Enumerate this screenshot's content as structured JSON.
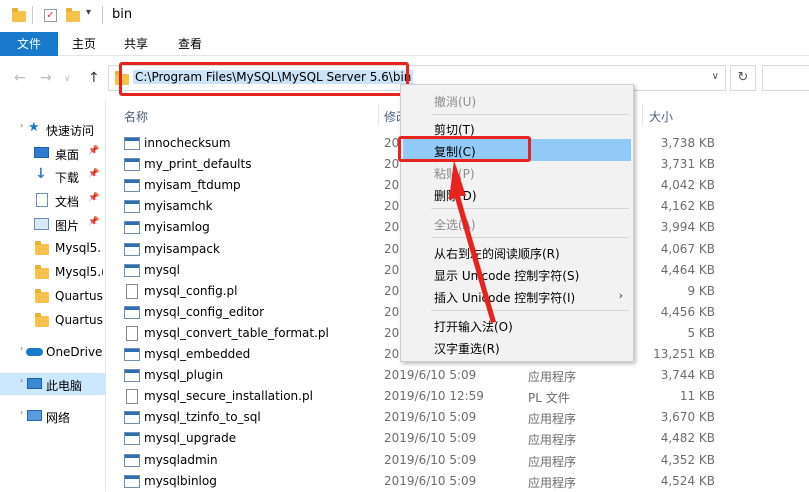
{
  "window": {
    "title": "bin"
  },
  "ribbon": {
    "tabs": [
      "文件",
      "主页",
      "共享",
      "查看"
    ]
  },
  "address": {
    "path": "C:\\Program Files\\MySQL\\MySQL Server 5.6\\bin"
  },
  "nav": {
    "items": [
      {
        "label": "快速访问",
        "icon": "star-icon"
      },
      {
        "label": "桌面",
        "icon": "desktop-icon",
        "pinned": true
      },
      {
        "label": "下载",
        "icon": "download-icon",
        "pinned": true
      },
      {
        "label": "文档",
        "icon": "document-icon",
        "pinned": true
      },
      {
        "label": "图片",
        "icon": "picture-icon",
        "pinned": true
      },
      {
        "label": "Mysql5.!",
        "icon": "folder-icon"
      },
      {
        "label": "Mysql5.(",
        "icon": "folder-icon"
      },
      {
        "label": "Quartus",
        "icon": "folder-icon"
      },
      {
        "label": "Quartus",
        "icon": "folder-icon"
      },
      {
        "label": "OneDrive",
        "icon": "cloud-icon"
      },
      {
        "label": "此电脑",
        "icon": "computer-icon"
      },
      {
        "label": "网络",
        "icon": "network-icon"
      }
    ]
  },
  "columns": {
    "name": "名称",
    "date": "修改",
    "size": "大小"
  },
  "files": [
    {
      "name": "innochecksum",
      "date": "20",
      "type": "",
      "size": "3,738 KB"
    },
    {
      "name": "my_print_defaults",
      "date": "20",
      "type": "",
      "size": "3,731 KB"
    },
    {
      "name": "myisam_ftdump",
      "date": "20",
      "type": "",
      "size": "4,042 KB"
    },
    {
      "name": "myisamchk",
      "date": "20",
      "type": "",
      "size": "4,162 KB"
    },
    {
      "name": "myisamlog",
      "date": "20",
      "type": "",
      "size": "3,994 KB"
    },
    {
      "name": "myisampack",
      "date": "20",
      "type": "",
      "size": "4,067 KB"
    },
    {
      "name": "mysql",
      "date": "20",
      "type": "",
      "size": "4,464 KB"
    },
    {
      "name": "mysql_config.pl",
      "date": "20",
      "type": "",
      "size": "9 KB"
    },
    {
      "name": "mysql_config_editor",
      "date": "20",
      "type": "",
      "size": "4,456 KB"
    },
    {
      "name": "mysql_convert_table_format.pl",
      "date": "20",
      "type": "",
      "size": "5 KB"
    },
    {
      "name": "mysql_embedded",
      "date": "20",
      "type": "",
      "size": "13,251 KB"
    },
    {
      "name": "mysql_plugin",
      "date": "2019/6/10 5:09",
      "type": "应用程序",
      "size": "3,744 KB"
    },
    {
      "name": "mysql_secure_installation.pl",
      "date": "2019/6/10 12:59",
      "type": "PL 文件",
      "size": "11 KB"
    },
    {
      "name": "mysql_tzinfo_to_sql",
      "date": "2019/6/10 5:09",
      "type": "应用程序",
      "size": "3,670 KB"
    },
    {
      "name": "mysql_upgrade",
      "date": "2019/6/10 5:09",
      "type": "应用程序",
      "size": "4,482 KB"
    },
    {
      "name": "mysqladmin",
      "date": "2019/6/10 5:09",
      "type": "应用程序",
      "size": "4,352 KB"
    },
    {
      "name": "mysqlbinlog",
      "date": "2019/6/10 5:09",
      "type": "应用程序",
      "size": "4,524 KB"
    }
  ],
  "context_menu": {
    "items": [
      {
        "label": "撤消(U)",
        "disabled": true
      },
      {
        "label": "剪切(T)",
        "disabled": false
      },
      {
        "label": "复制(C)",
        "disabled": false,
        "highlighted": true
      },
      {
        "label": "粘贴(P)",
        "disabled": true
      },
      {
        "label": "删除(D)",
        "disabled": false
      },
      {
        "label": "全选(A)",
        "disabled": true
      },
      {
        "label": "从右到左的阅读顺序(R)",
        "disabled": false
      },
      {
        "label": "显示 Unicode 控制字符(S)",
        "disabled": false
      },
      {
        "label": "插入 Unicode 控制字符(I)",
        "disabled": false,
        "submenu": true
      },
      {
        "label": "打开输入法(O)",
        "disabled": false
      },
      {
        "label": "汉字重选(R)",
        "disabled": false
      }
    ]
  },
  "colors": {
    "accent": "#1979ca",
    "annotation": "#e8231f",
    "highlight": "#91c9f7"
  }
}
